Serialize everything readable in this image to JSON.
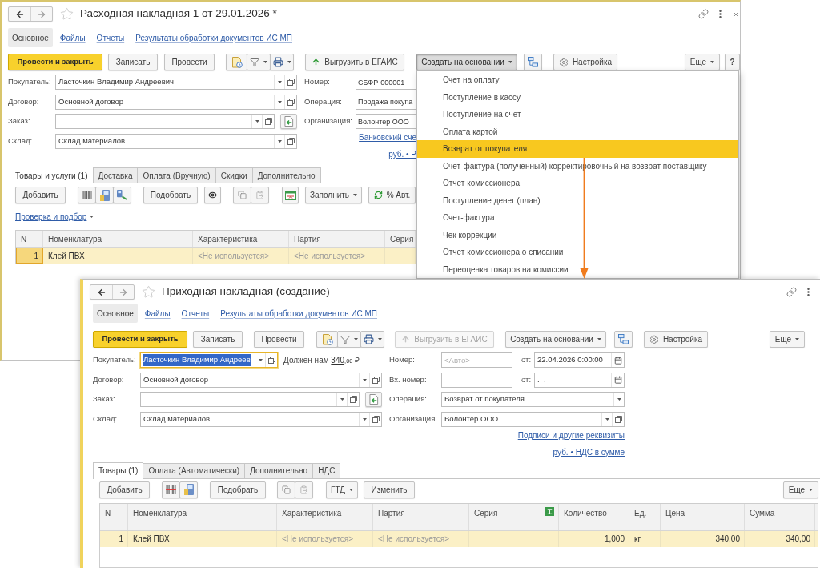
{
  "back_window": {
    "title": "Расходная накладная 1 от 29.01.2026 *",
    "sections": [
      {
        "label": "Основное",
        "selected": true
      },
      {
        "label": "Файлы",
        "selected": false
      },
      {
        "label": "Отчеты",
        "selected": false
      },
      {
        "label": "Результаты обработки документов ИС МП",
        "selected": false
      }
    ],
    "toolbar": {
      "post_and_close": "Провести и закрыть",
      "save": "Записать",
      "post": "Провести",
      "egais": {
        "label": "Выгрузить в ЕГАИС",
        "disabled": false
      },
      "create_based": {
        "label": "Создать на основании",
        "pressed": true
      },
      "settings": "Настройка",
      "more": "Еще",
      "help": "?"
    },
    "create_menu": {
      "items": [
        {
          "label": "Счет на оплату",
          "selected": false
        },
        {
          "label": "Поступление в кассу",
          "selected": false
        },
        {
          "label": "Поступление на счет",
          "selected": false
        },
        {
          "label": "Оплата картой",
          "selected": false
        },
        {
          "label": "Возврат от покупателя",
          "selected": true
        },
        {
          "label": "Счет-фактура (полученный) корректировочный на возврат поставщику",
          "selected": false
        },
        {
          "label": "Отчет комиссионера",
          "selected": false
        },
        {
          "label": "Поступление денег (план)",
          "selected": false
        },
        {
          "label": "Счет-фактура",
          "selected": false
        },
        {
          "label": "Чек коррекции",
          "selected": false
        },
        {
          "label": "Отчет комиссионера о списании",
          "selected": false
        },
        {
          "label": "Переоценка товаров на комиссии",
          "selected": false
        }
      ]
    },
    "fields_left": [
      {
        "kind": "select",
        "label": "Покупатель:",
        "value": "Ласточкин Владимир Андреевич",
        "focused": false
      },
      {
        "kind": "select",
        "label": "Договор:",
        "value": "Основной договор",
        "focused": false
      },
      {
        "kind": "select_create",
        "label": "Заказ:",
        "focused": false
      },
      {
        "kind": "select",
        "label": "Склад:",
        "value": "Склад материалов",
        "focused": false
      }
    ],
    "fields_right": [
      {
        "kind": "text",
        "label": "Номер:",
        "value": "СБФР-000001"
      },
      {
        "kind": "text",
        "label": "Операция:",
        "value": "Продажа покупа"
      },
      {
        "kind": "text",
        "label": "Организация:",
        "value": "Волонтер ООО"
      }
    ],
    "links": [
      "Банковский сче",
      "руб. • Р"
    ],
    "tabs": [
      {
        "label": "Товары и услуги (1)",
        "selected": true
      },
      {
        "label": "Доставка",
        "selected": false
      },
      {
        "label": "Оплата (Вручную)",
        "selected": false
      },
      {
        "label": "Скидки",
        "selected": false
      },
      {
        "label": "Дополнительно",
        "selected": false
      }
    ],
    "table_toolbar": {
      "add": "Добавить",
      "pick": "Подобрать",
      "fill": "Заполнить",
      "auto_discount": "% Авт."
    },
    "check_link": "Проверка и подбор",
    "table": {
      "columns": [
        {
          "label": "N",
          "kind": "number"
        },
        {
          "label": "Номенклатура",
          "kind": "text"
        },
        {
          "label": "Характеристика",
          "kind": "text"
        },
        {
          "label": "Партия",
          "kind": "text"
        },
        {
          "label": "Серия",
          "kind": "text"
        }
      ],
      "rows": [
        {
          "selected": true,
          "cells": [
            {
              "value": "1",
              "current": true
            },
            "Клей ПВХ",
            {
              "value": "<Не используется>",
              "dimmed": true
            },
            {
              "value": "<Не используется>",
              "dimmed": true
            }
          ]
        }
      ]
    }
  },
  "front_window": {
    "title": "Приходная накладная (создание)",
    "sections": [
      {
        "label": "Основное",
        "selected": true
      },
      {
        "label": "Файлы",
        "selected": false
      },
      {
        "label": "Отчеты",
        "selected": false
      },
      {
        "label": "Результаты обработки документов ИС МП",
        "selected": false
      }
    ],
    "toolbar": {
      "post_and_close": "Провести и закрыть",
      "save": "Записать",
      "post": "Провести",
      "egais": {
        "label": "Выгрузить в ЕГАИС",
        "disabled": true
      },
      "create_based": {
        "label": "Создать на основании",
        "pressed": false
      },
      "settings": "Настройка",
      "more": "Еще"
    },
    "fields_left": [
      {
        "kind": "select",
        "label": "Покупатель:",
        "value": "Ласточкин Владимир Андреев",
        "focused": true,
        "debt": {
          "label": "Должен нам",
          "amount": "340",
          "fraction": ",00",
          "currency": "₽"
        }
      },
      {
        "kind": "select",
        "label": "Договор:",
        "value": "Основной договор",
        "focused": false
      },
      {
        "kind": "select_create",
        "label": "Заказ:",
        "focused": false
      },
      {
        "kind": "select",
        "label": "Склад:",
        "value": "Склад материалов",
        "focused": false
      }
    ],
    "fields_right": [
      {
        "kind": "text",
        "label": "Номер:",
        "placeholder": "<Авто>",
        "date": {
          "label": "от:",
          "value": "22.04.2026 0:00:00"
        }
      },
      {
        "kind": "text",
        "label": "Вх. номер:",
        "date": {
          "label": "от:",
          "value": ".  ."
        }
      },
      {
        "kind": "choice",
        "label": "Операция:",
        "value": "Возврат от покупателя"
      },
      {
        "kind": "select",
        "label": "Организация:",
        "value": "Волонтер ООО"
      }
    ],
    "links": [
      "Подписи и другие реквизиты",
      "руб. • НДС в сумме"
    ],
    "tabs": [
      {
        "label": "Товары (1)",
        "selected": true
      },
      {
        "label": "Оплата (Автоматически)",
        "selected": false
      },
      {
        "label": "Дополнительно",
        "selected": false
      },
      {
        "label": "НДС",
        "selected": false
      }
    ],
    "table_toolbar": {
      "add": "Добавить",
      "pick": "Подобрать",
      "gtd": "ГТД",
      "edit": "Изменить",
      "more": "Еще"
    },
    "table": {
      "columns": [
        {
          "label": "N",
          "kind": "number"
        },
        {
          "label": "Номенклатура",
          "kind": "text"
        },
        {
          "label": "Характеристика",
          "kind": "text"
        },
        {
          "label": "Партия",
          "kind": "text"
        },
        {
          "label": "Серия",
          "kind": "text"
        },
        {
          "kind": "icon"
        },
        {
          "label": "Количество",
          "kind": "number"
        },
        {
          "label": "Ед.",
          "kind": "text"
        },
        {
          "label": "Цена",
          "kind": "number"
        },
        {
          "label": "Сумма",
          "kind": "number"
        }
      ],
      "rows": [
        {
          "selected": true,
          "cells": [
            "1",
            "Клей ПВХ",
            {
              "value": "<Не используется>",
              "dimmed": true
            },
            {
              "value": "<Не используется>",
              "dimmed": true
            },
            null,
            null,
            "1,000",
            "кг",
            "340,00",
            "340,00"
          ]
        }
      ]
    }
  }
}
